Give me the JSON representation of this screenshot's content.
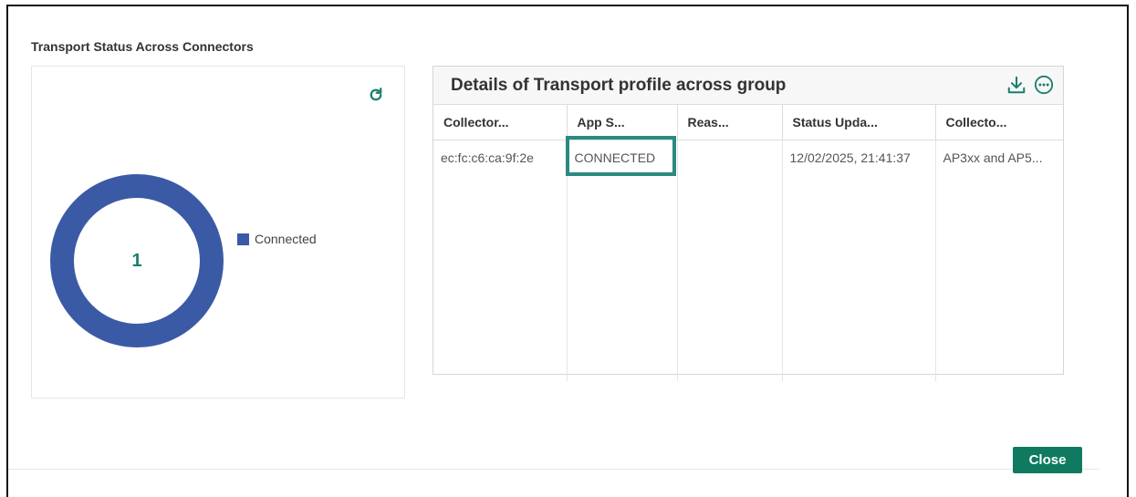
{
  "modal": {
    "title": "Transport Status Across Connectors"
  },
  "chart_data": {
    "type": "pie",
    "variant": "donut",
    "center_label": "1",
    "categories": [
      "Connected"
    ],
    "values": [
      1
    ],
    "colors": [
      "#3b5aa5"
    ],
    "legend_placement": "right"
  },
  "details": {
    "title": "Details of Transport profile across group",
    "columns": [
      "Collector...",
      "App S...",
      "Reas...",
      "Status Upda...",
      "Collecto..."
    ],
    "rows": [
      [
        "ec:fc:c6:ca:9f:2e",
        "CONNECTED",
        "",
        "12/02/2025, 21:41:37",
        "AP3xx and AP5..."
      ]
    ]
  },
  "icons": {
    "refresh": "refresh-icon",
    "download": "download-icon",
    "more": "more-options-icon"
  },
  "colors": {
    "accent": "#1a7f6e",
    "button": "#0f7a5f",
    "highlight": "#2a8a80",
    "series": "#3b5aa5"
  },
  "footer": {
    "close_label": "Close"
  }
}
